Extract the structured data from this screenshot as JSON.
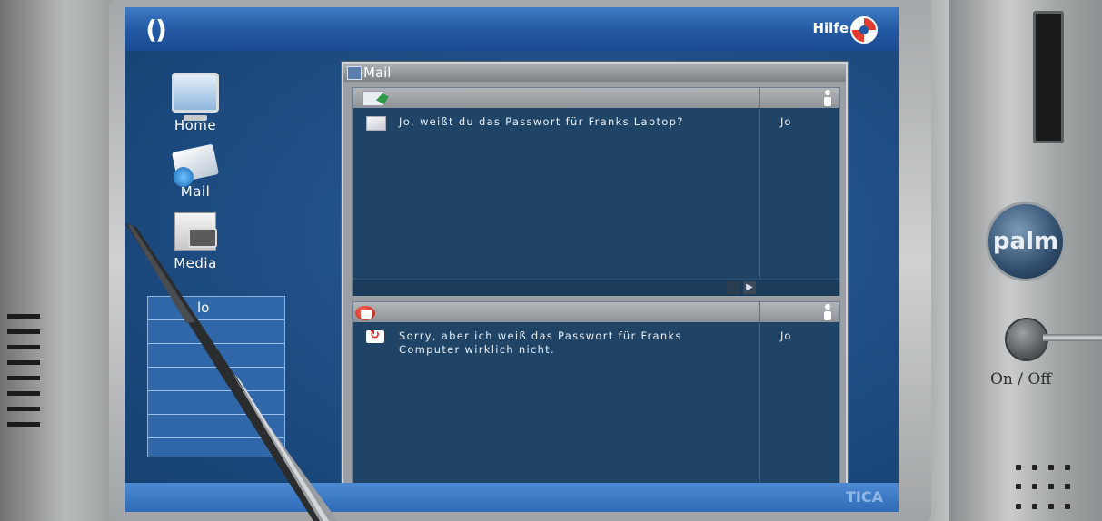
{
  "header": {
    "help_label": "Hilfe",
    "sync_icon": "sync-icon",
    "help_icon": "lifebuoy-icon"
  },
  "launcher": {
    "home_label": "Home",
    "mail_label": "Mail",
    "media_label": "Media"
  },
  "side_list": {
    "items": [
      "lo",
      "t",
      "",
      "",
      "",
      ""
    ]
  },
  "mail_window": {
    "title": "Mail",
    "inbox": {
      "messages": [
        {
          "text": "Jo, weißt du das Passwort für Franks Laptop?",
          "sender": "Jo"
        }
      ]
    },
    "reply": {
      "messages": [
        {
          "text": "Sorry, aber ich weiß das Passwort für Franks Computer wirklich nicht.",
          "sender": "Jo"
        }
      ]
    }
  },
  "bottom_bar": {
    "brand_text": "TICA"
  },
  "device": {
    "logo": "palm",
    "power_label": "On / Off"
  },
  "colors": {
    "screen_blue": "#1f4f86",
    "titlebar_blue": "#2358a3",
    "pane_navy": "#1f4466"
  }
}
